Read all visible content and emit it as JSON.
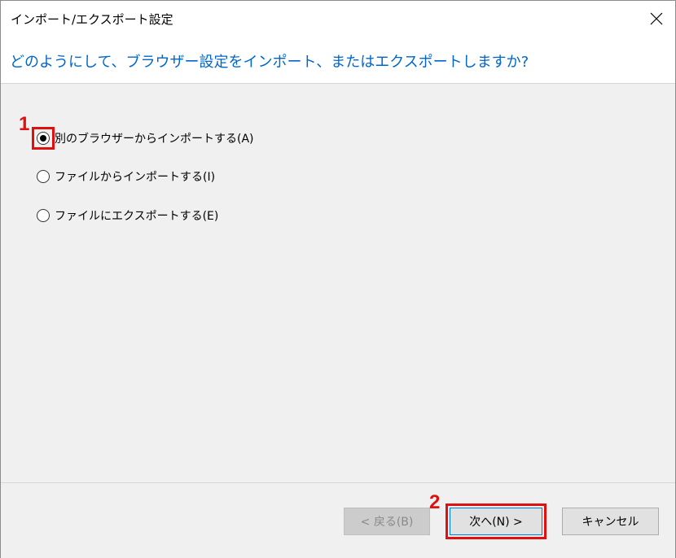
{
  "window": {
    "title": "インポート/エクスポート設定"
  },
  "header": {
    "question": "どのようにして、ブラウザー設定をインポート、またはエクスポートしますか?"
  },
  "options": [
    {
      "label": "別のブラウザーからインポートする(A)",
      "checked": true
    },
    {
      "label": "ファイルからインポートする(I)",
      "checked": false
    },
    {
      "label": "ファイルにエクスポートする(E)",
      "checked": false
    }
  ],
  "annotations": {
    "step1": "1",
    "step2": "2",
    "highlight_color": "#e01010"
  },
  "buttons": {
    "back": "< 戻る(B)",
    "next": "次へ(N) >",
    "cancel": "キャンセル"
  },
  "colors": {
    "header_text": "#0066cc",
    "background": "#f0f0f0"
  }
}
